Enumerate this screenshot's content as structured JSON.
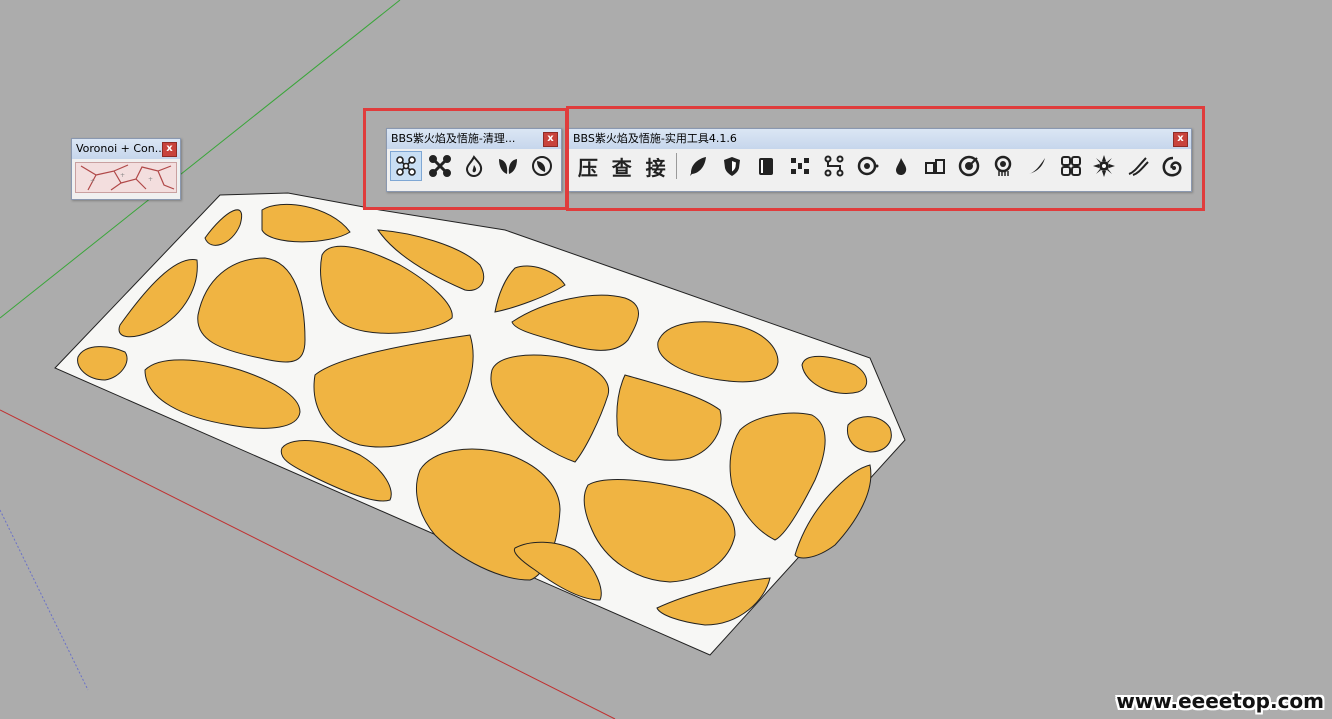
{
  "colors": {
    "background": "#acacac",
    "model_frame": "#f7f7f5",
    "cell_fill": "#f0b442",
    "highlight": "#e03c3c"
  },
  "voronoi_toolbar": {
    "title": "Voronoi + Con...",
    "close": "x",
    "icon": "voronoi-pattern-icon"
  },
  "cleanup_toolbar": {
    "title": "BBS紫火焰及悟施-清理...",
    "close": "x",
    "buttons": [
      {
        "icon": "nodes-icon",
        "active": true
      },
      {
        "icon": "cross-nodes-icon"
      },
      {
        "icon": "flame-icon"
      },
      {
        "icon": "leaves-icon"
      },
      {
        "icon": "leaf-circle-icon"
      }
    ]
  },
  "utility_toolbar": {
    "title": "BBS紫火焰及悟施-实用工具4.1.6",
    "close": "x",
    "text_buttons": [
      "压",
      "查",
      "接"
    ],
    "buttons": [
      {
        "icon": "feather-icon"
      },
      {
        "icon": "shield-icon"
      },
      {
        "icon": "book-icon"
      },
      {
        "icon": "stairs-icon"
      },
      {
        "icon": "branch-icon"
      },
      {
        "icon": "dotted-circle-icon"
      },
      {
        "icon": "drop-icon"
      },
      {
        "icon": "two-boxes-icon"
      },
      {
        "icon": "target-icon"
      },
      {
        "icon": "badge-icon"
      },
      {
        "icon": "slash-curve-icon"
      },
      {
        "icon": "four-squares-icon"
      },
      {
        "icon": "gear-flower-icon"
      },
      {
        "icon": "double-curve-icon"
      },
      {
        "icon": "spiral-icon"
      }
    ]
  },
  "watermark": "www.eeeetop.com"
}
